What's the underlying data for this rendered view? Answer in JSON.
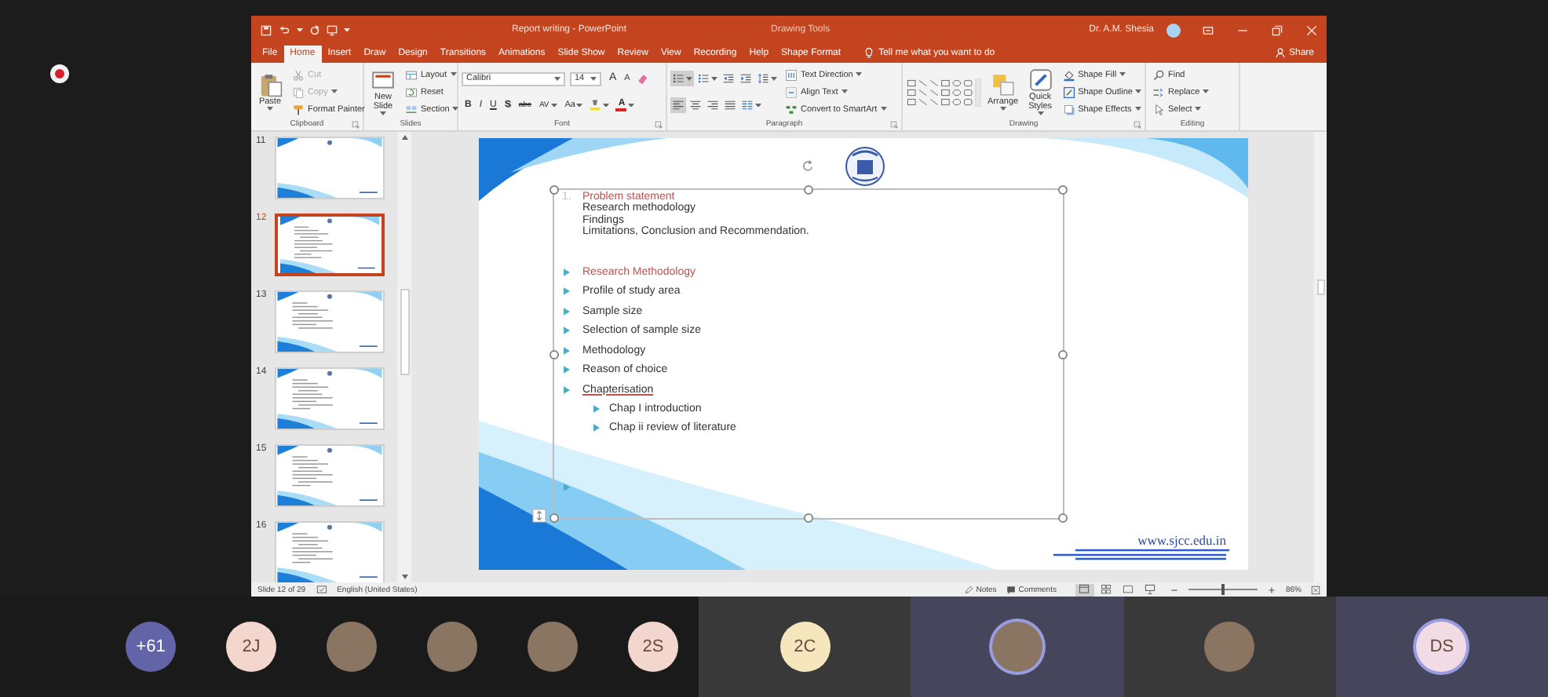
{
  "recording": {
    "on": true
  },
  "app": {
    "title": "Report writing - PowerPoint",
    "context_label": "Drawing Tools",
    "user_name": "Dr. A.M. Shesia",
    "tabs": [
      {
        "label": "File",
        "selected": false
      },
      {
        "label": "Home",
        "selected": true
      },
      {
        "label": "Insert",
        "selected": false
      },
      {
        "label": "Draw",
        "selected": false
      },
      {
        "label": "Design",
        "selected": false
      },
      {
        "label": "Transitions",
        "selected": false
      },
      {
        "label": "Animations",
        "selected": false
      },
      {
        "label": "Slide Show",
        "selected": false
      },
      {
        "label": "Review",
        "selected": false
      },
      {
        "label": "View",
        "selected": false
      },
      {
        "label": "Recording",
        "selected": false
      },
      {
        "label": "Help",
        "selected": false
      },
      {
        "label": "Shape Format",
        "selected": false
      }
    ],
    "tell_me": "Tell me what you want to do",
    "share": "Share",
    "ribbon": [
      {
        "label": "Clipboard",
        "launcher": true,
        "columns": [
          [
            [
              {
                "kind": "large",
                "label": "Paste",
                "dropdown": true,
                "disabled": false
              }
            ]
          ],
          [
            [
              {
                "kind": "small",
                "label": "Cut",
                "dropdown": false,
                "disabled": true
              }
            ],
            [
              {
                "kind": "small",
                "label": "Copy",
                "dropdown": true,
                "disabled": true
              }
            ],
            [
              {
                "kind": "small",
                "label": "Format Painter",
                "dropdown": false,
                "disabled": false
              }
            ]
          ]
        ]
      },
      {
        "label": "Slides",
        "launcher": false,
        "columns": [
          [
            [
              {
                "kind": "large",
                "label": "New Slide",
                "dropdown": true,
                "disabled": false
              }
            ]
          ],
          [
            [
              {
                "kind": "small",
                "label": "Layout",
                "dropdown": true,
                "disabled": false
              }
            ],
            [
              {
                "kind": "small",
                "label": "Reset",
                "dropdown": false,
                "disabled": false
              }
            ],
            [
              {
                "kind": "small",
                "label": "Section",
                "dropdown": true,
                "disabled": false
              }
            ]
          ]
        ]
      },
      {
        "label": "Font",
        "launcher": true,
        "columns": [
          [
            [
              {
                "kind": "field",
                "label": "Calibri",
                "dropdown": true
              },
              {
                "kind": "field",
                "label": "14",
                "dropdown": true
              },
              {
                "kind": "glyph",
                "label": "A",
                "dropdown": false
              },
              {
                "kind": "glyph",
                "label": "A",
                "dropdown": false
              },
              {
                "kind": "icon",
                "dropdown": false,
                "selected": false
              }
            ],
            [
              {
                "kind": "glyph",
                "label": "B",
                "dropdown": false
              },
              {
                "kind": "glyph",
                "label": "I",
                "dropdown": false
              },
              {
                "kind": "glyph",
                "label": "U",
                "dropdown": false
              },
              {
                "kind": "glyph",
                "label": "S",
                "dropdown": false
              },
              {
                "kind": "glyph",
                "label": "abc",
                "dropdown": false
              },
              {
                "kind": "glyph",
                "label": "AV",
                "dropdown": true
              },
              {
                "kind": "glyph",
                "label": "Aa",
                "dropdown": true
              },
              {
                "kind": "icon",
                "dropdown": true,
                "selected": false
              },
              {
                "kind": "glyph",
                "label": "A",
                "color": "#e02020",
                "dropdown": true
              }
            ]
          ]
        ]
      },
      {
        "label": "Paragraph",
        "launcher": true,
        "columns": [
          [
            [
              {
                "kind": "icon",
                "dropdown": true,
                "selected": true
              },
              {
                "kind": "icon",
                "dropdown": true,
                "selected": false
              },
              {
                "kind": "icon",
                "dropdown": false,
                "selected": false
              },
              {
                "kind": "icon",
                "dropdown": false,
                "selected": false
              },
              {
                "kind": "icon",
                "dropdown": true,
                "selected": false
              }
            ],
            [
              {
                "kind": "icon",
                "dropdown": false,
                "selected": true
              },
              {
                "kind": "icon",
                "dropdown": false,
                "selected": false
              },
              {
                "kind": "icon",
                "dropdown": false,
                "selected": false
              },
              {
                "kind": "icon",
                "dropdown": false,
                "selected": false
              },
              {
                "kind": "icon",
                "dropdown": true,
                "selected": false
              }
            ]
          ],
          [
            [
              {
                "kind": "small",
                "label": "Text Direction",
                "dropdown": true,
                "disabled": false
              }
            ],
            [
              {
                "kind": "small",
                "label": "Align Text",
                "dropdown": true,
                "disabled": false
              }
            ],
            [
              {
                "kind": "small",
                "label": "Convert to SmartArt",
                "dropdown": true,
                "disabled": false
              }
            ]
          ]
        ]
      },
      {
        "label": "Drawing",
        "launcher": true,
        "columns": [
          [
            [
              {
                "kind": "gallery"
              }
            ]
          ],
          [
            [
              {
                "kind": "large",
                "label": "Arrange",
                "dropdown": true,
                "disabled": false
              }
            ]
          ],
          [
            [
              {
                "kind": "large",
                "label": "Quick Styles",
                "dropdown": true,
                "disabled": false
              }
            ]
          ],
          [
            [
              {
                "kind": "small",
                "label": "Shape Fill",
                "dropdown": true,
                "disabled": false
              }
            ],
            [
              {
                "kind": "small",
                "label": "Shape Outline",
                "dropdown": true,
                "disabled": false
              }
            ],
            [
              {
                "kind": "small",
                "label": "Shape Effects",
                "dropdown": true,
                "disabled": false
              }
            ]
          ]
        ]
      },
      {
        "label": "Editing",
        "launcher": false,
        "columns": [
          [
            [
              {
                "kind": "small",
                "label": "Find",
                "dropdown": false,
                "disabled": false
              }
            ],
            [
              {
                "kind": "small",
                "label": "Replace",
                "dropdown": true,
                "disabled": false
              }
            ],
            [
              {
                "kind": "small",
                "label": "Select",
                "dropdown": true,
                "disabled": false
              }
            ]
          ]
        ]
      }
    ],
    "thumbnails": [
      {
        "number": "11",
        "selected": false
      },
      {
        "number": "12",
        "selected": true
      },
      {
        "number": "13",
        "selected": false
      },
      {
        "number": "14",
        "selected": false
      },
      {
        "number": "15",
        "selected": false
      },
      {
        "number": "16",
        "selected": false
      }
    ],
    "slide": {
      "top_block": {
        "number": "1.",
        "lines": [
          {
            "text": "Problem statement",
            "highlight": true
          },
          {
            "text": "Research methodology",
            "highlight": false
          },
          {
            "text": "Findings",
            "highlight": false
          },
          {
            "text": "Limitations, Conclusion and Recommendation.",
            "highlight": false
          }
        ]
      },
      "bullets": [
        {
          "kind": "bullet",
          "text": "Research Methodology",
          "highlight": true,
          "underlined": false
        },
        {
          "kind": "bullet",
          "text": "Profile of study area",
          "highlight": false,
          "underlined": false
        },
        {
          "kind": "bullet",
          "text": "Sample size",
          "highlight": false,
          "underlined": false
        },
        {
          "kind": "bullet",
          "text": "Selection of sample  size",
          "highlight": false,
          "underlined": false
        },
        {
          "kind": "bullet",
          "text": "Methodology",
          "highlight": false,
          "underlined": false
        },
        {
          "kind": "bullet",
          "text": "Reason of choice",
          "highlight": false,
          "underlined": false
        },
        {
          "kind": "bullet",
          "text": "Chapterisation",
          "highlight": false,
          "underlined": true,
          "children": [
            {
              "kind": "bullet",
              "text": "Chap I introduction",
              "highlight": false,
              "underlined": false
            },
            {
              "kind": "bullet",
              "text": "Chap ii review  of literature",
              "highlight": false,
              "underlined": false
            }
          ]
        },
        {
          "kind": "empty"
        }
      ],
      "footer_url": "www.sjcc.edu.in"
    },
    "status_bar": {
      "slide_info": "Slide 12 of 29",
      "language": "English (United States)",
      "notes": "Notes",
      "comments": "Comments",
      "views": [
        {
          "selected": true
        },
        {
          "selected": false
        },
        {
          "selected": false
        },
        {
          "selected": false
        }
      ],
      "zoom": {
        "level": 0.5,
        "reading": "86%"
      }
    }
  },
  "participants": [
    {
      "kind": "overflow",
      "label": "+61",
      "color": "#6264a7",
      "tiled": false,
      "speaking": false
    },
    {
      "kind": "initials",
      "label": "2J",
      "color": "#f3d6cd",
      "tiled": false,
      "speaking": false
    },
    {
      "kind": "photo",
      "tiled": false,
      "speaking": false
    },
    {
      "kind": "photo",
      "tiled": false,
      "speaking": false
    },
    {
      "kind": "photo",
      "tiled": false,
      "speaking": false
    },
    {
      "kind": "initials",
      "label": "2S",
      "color": "#f3d6cd",
      "tiled": false,
      "speaking": false
    },
    {
      "kind": "initials",
      "label": "2C",
      "color": "#f6e6bd",
      "tiled": true,
      "speaking": false
    },
    {
      "kind": "photo",
      "tiled": true,
      "speaking": true
    },
    {
      "kind": "photo",
      "tiled": true,
      "speaking": false
    },
    {
      "kind": "initials",
      "label": "DS",
      "color": "#f1dbe4",
      "tiled": true,
      "speaking": true
    }
  ]
}
